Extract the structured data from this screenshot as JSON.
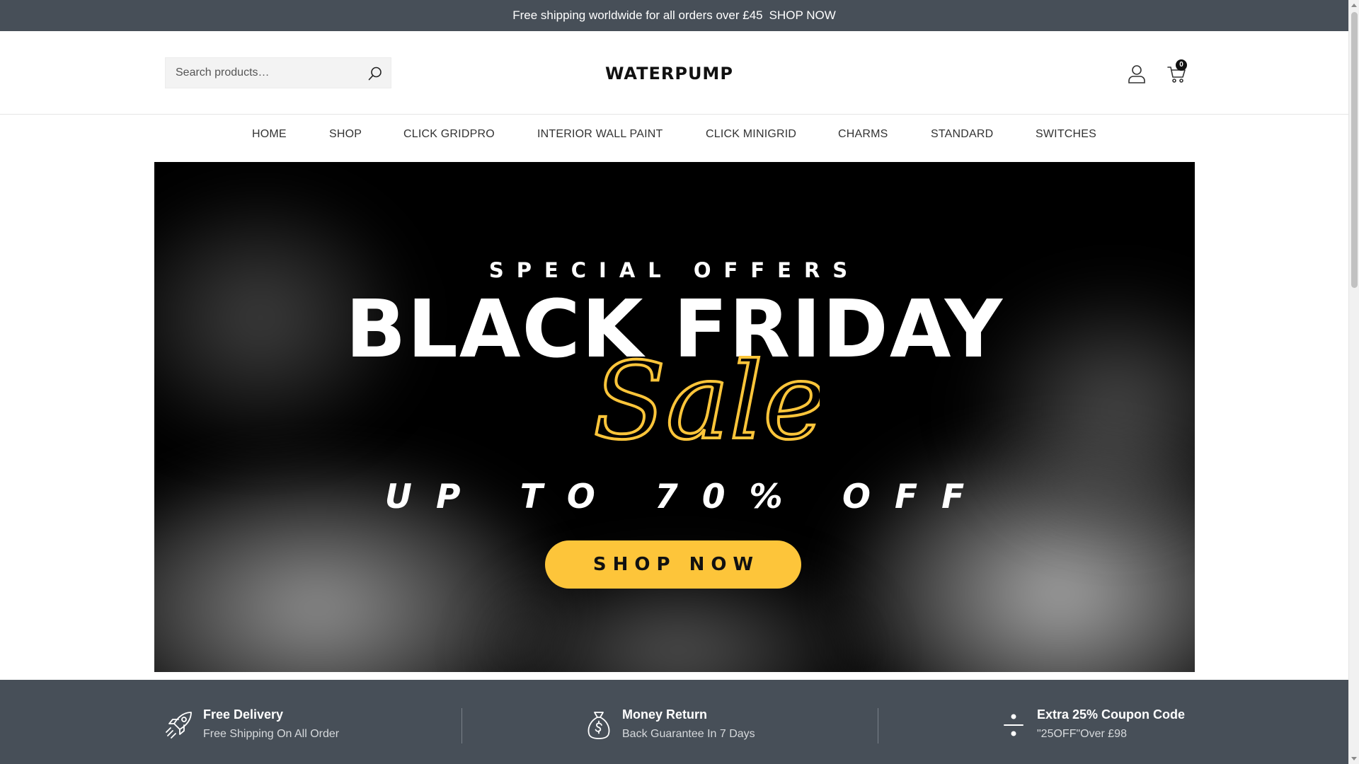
{
  "topbar": {
    "message": "Free shipping worldwide for all orders over £45",
    "link_label": "SHOP NOW"
  },
  "header": {
    "search_placeholder": "Search products…",
    "logo_text": "WATERPUMP",
    "cart_count": "0"
  },
  "nav": {
    "items": [
      {
        "label": "HOME"
      },
      {
        "label": "SHOP"
      },
      {
        "label": "CLICK GRIDPRO"
      },
      {
        "label": "INTERIOR WALL PAINT"
      },
      {
        "label": "CLICK MINIGRID"
      },
      {
        "label": "CHARMS"
      },
      {
        "label": "STANDARD"
      },
      {
        "label": "SWITCHES"
      }
    ]
  },
  "hero": {
    "tagline": "SPECIAL OFFERS",
    "title": "BLACK FRIDAY",
    "script_text": "Sale",
    "discount": "UP TO 70% OFF",
    "cta_label": "SHOP NOW",
    "accent_color": "#fdc53a"
  },
  "features": [
    {
      "icon": "rocket-icon",
      "title": "Free Delivery",
      "subtitle": "Free Shipping On All Order"
    },
    {
      "icon": "money-bag-icon",
      "title": "Money Return",
      "subtitle": "Back Guarantee In 7 Days"
    },
    {
      "icon": "divide-icon",
      "title": "Extra 25% Coupon Code",
      "subtitle": "\"25OFF\"Over £98"
    }
  ],
  "colors": {
    "topbar_bg": "#474f58",
    "features_bg": "#474f58"
  }
}
